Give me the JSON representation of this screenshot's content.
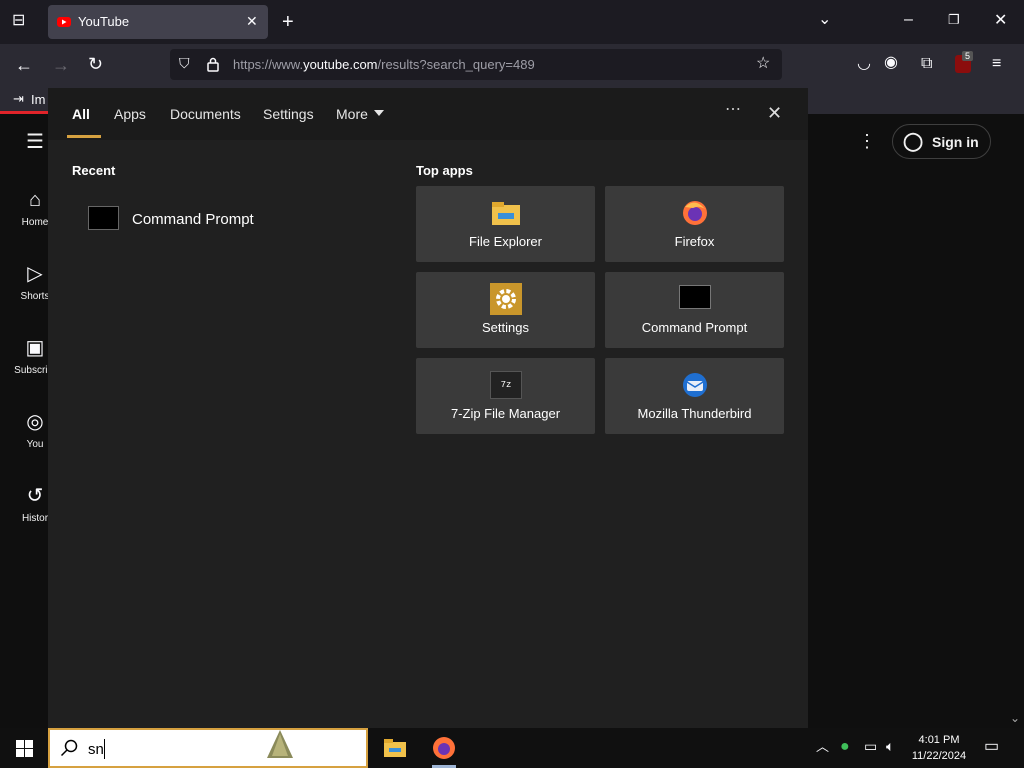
{
  "browser": {
    "tab_title": "YouTube",
    "url_prefix": "https://www.",
    "url_domain": "youtube.com",
    "url_path": "/results?search_query=489",
    "bookmark_label": "Im",
    "extension_badge": "5"
  },
  "youtube": {
    "nav": [
      "Home",
      "Shorts",
      "Subscript",
      "You",
      "Histor"
    ],
    "sign_in": "Sign in"
  },
  "search_panel": {
    "tabs": {
      "all": "All",
      "apps": "Apps",
      "documents": "Documents",
      "settings": "Settings",
      "more": "More"
    },
    "recent_header": "Recent",
    "recent_items": [
      "Command Prompt"
    ],
    "top_apps_header": "Top apps",
    "top_apps": [
      "File Explorer",
      "Firefox",
      "Settings",
      "Command Prompt",
      "7-Zip File Manager",
      "Mozilla Thunderbird"
    ]
  },
  "taskbar": {
    "search_text": "sn",
    "time": "4:01 PM",
    "date": "11/22/2024"
  },
  "colors": {
    "accent": "#d6a140",
    "panel": "#202020",
    "tile": "#3a3a3a"
  }
}
